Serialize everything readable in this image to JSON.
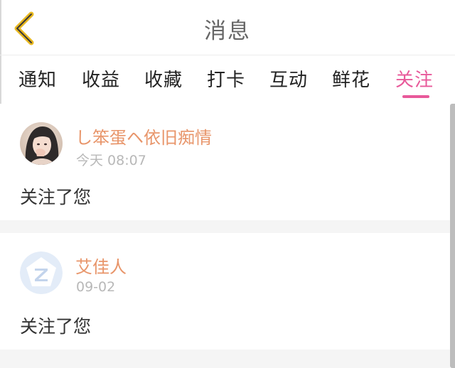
{
  "header": {
    "title": "消息",
    "back_icon": "chevron-left-icon",
    "accent_color": "#e8b820"
  },
  "tabs": [
    {
      "label": "通知",
      "active": false
    },
    {
      "label": "收益",
      "active": false
    },
    {
      "label": "收藏",
      "active": false
    },
    {
      "label": "打卡",
      "active": false
    },
    {
      "label": "互动",
      "active": false
    },
    {
      "label": "鲜花",
      "active": false
    },
    {
      "label": "关注",
      "active": true
    }
  ],
  "colors": {
    "active_tab": "#e8599a",
    "username": "#e8956a",
    "timestamp": "#b8b8b8"
  },
  "notifications": [
    {
      "username": "し笨蛋ヘ依旧痴情",
      "time": "今天 08:07",
      "message": "关注了您",
      "avatar": "user-photo"
    },
    {
      "username": "艾佳人",
      "time": "09-02",
      "message": "关注了您",
      "avatar": "default-qq-avatar-icon"
    }
  ]
}
